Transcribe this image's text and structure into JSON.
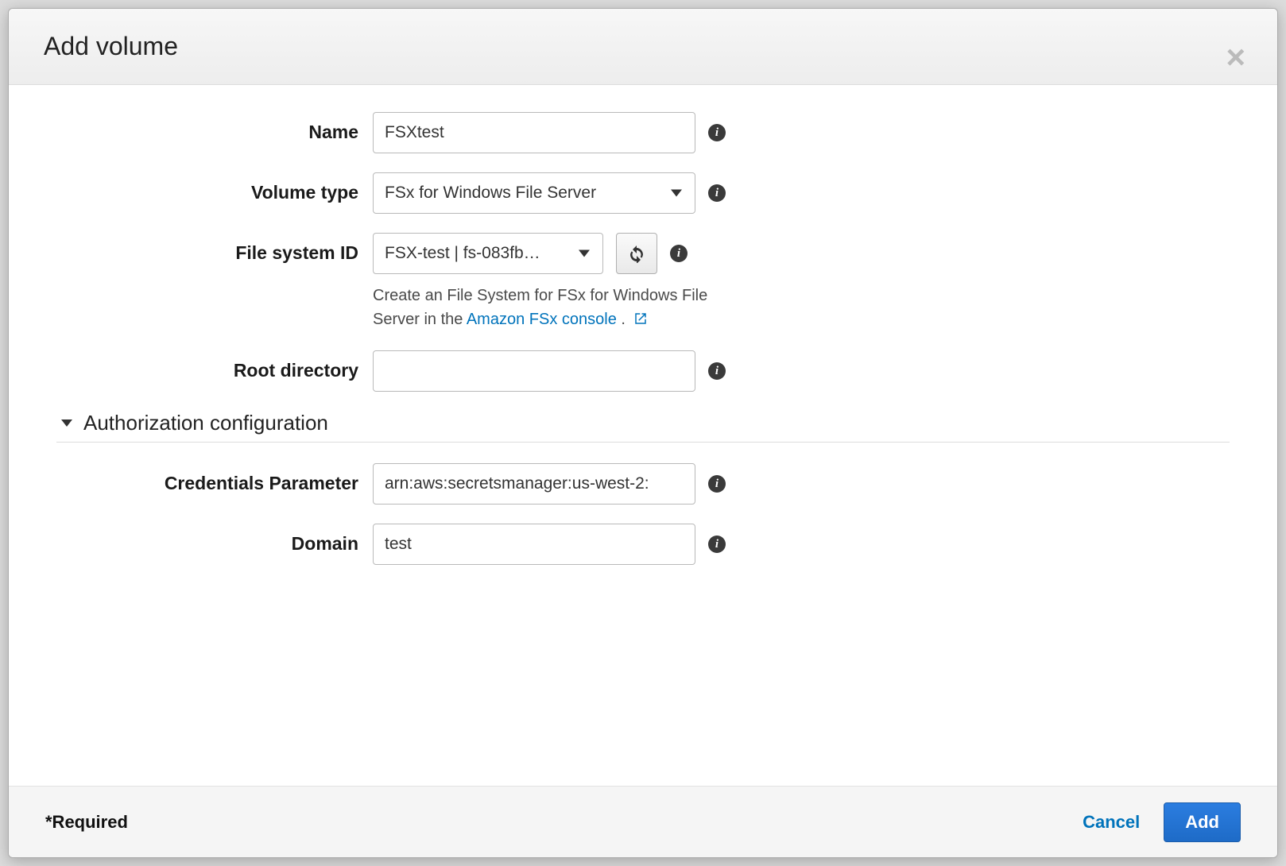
{
  "modal": {
    "title": "Add volume"
  },
  "form": {
    "name": {
      "label": "Name",
      "value": "FSXtest"
    },
    "volume_type": {
      "label": "Volume type",
      "selected": "FSx for Windows File Server"
    },
    "file_system_id": {
      "label": "File system ID",
      "selected": "FSX-test | fs-083fb…",
      "helper_prefix": "Create an File System for FSx for Windows File Server in the ",
      "helper_link_text": "Amazon FSx console",
      "helper_suffix": " ."
    },
    "root_directory": {
      "label": "Root directory",
      "value": ""
    },
    "section_authorization": "Authorization configuration",
    "credentials_parameter": {
      "label": "Credentials Parameter",
      "value": "arn:aws:secretsmanager:us-west-2:"
    },
    "domain": {
      "label": "Domain",
      "value": "test"
    }
  },
  "footer": {
    "required_note": "*Required",
    "cancel": "Cancel",
    "add": "Add"
  },
  "icons": {
    "info_glyph": "i",
    "close_glyph": "×"
  }
}
